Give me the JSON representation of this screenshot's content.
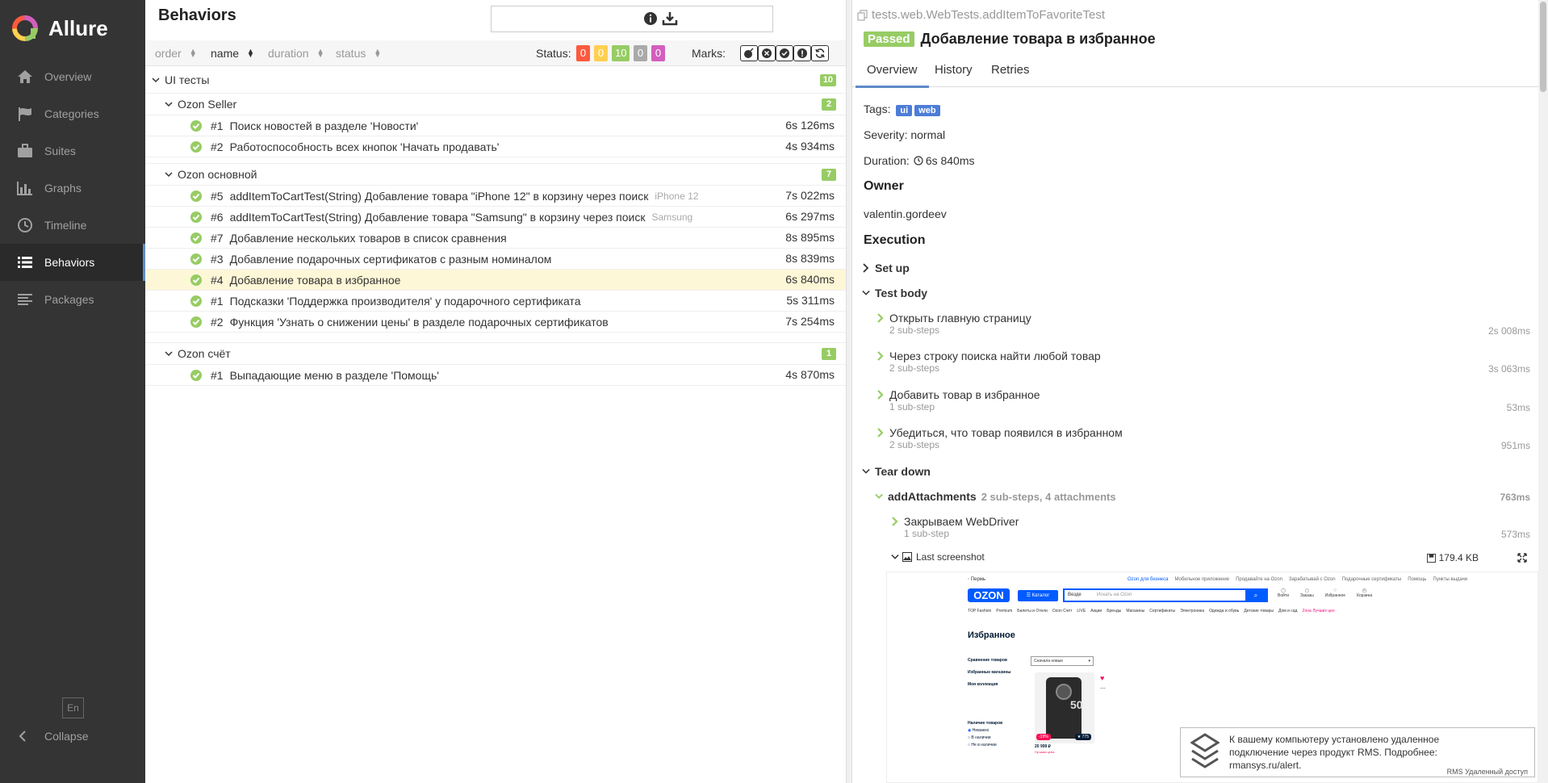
{
  "sidebar": {
    "brand": "Allure",
    "items": [
      {
        "label": "Overview",
        "icon": "home-icon"
      },
      {
        "label": "Categories",
        "icon": "flag-icon"
      },
      {
        "label": "Suites",
        "icon": "briefcase-icon"
      },
      {
        "label": "Graphs",
        "icon": "bar-chart-icon"
      },
      {
        "label": "Timeline",
        "icon": "clock-icon"
      },
      {
        "label": "Behaviors",
        "icon": "list-icon",
        "active": true
      },
      {
        "label": "Packages",
        "icon": "align-left-icon"
      }
    ],
    "lang": "En",
    "collapse": "Collapse"
  },
  "middle": {
    "title": "Behaviors",
    "search_value": "",
    "sort": {
      "order": "order",
      "name": "name",
      "duration": "duration",
      "status": "status"
    },
    "status_label": "Status:",
    "status_counts": [
      "0",
      "0",
      "10",
      "0",
      "0"
    ],
    "status_colors": [
      "#fd5a3e",
      "#ffd050",
      "#97cc64",
      "#aaaaaa",
      "#d35ebe"
    ],
    "marks_label": "Marks:",
    "root": {
      "label": "UI тесты",
      "count": "10"
    },
    "groups": [
      {
        "label": "Ozon Seller",
        "count": "2",
        "tests": [
          {
            "num": "#1",
            "name": "Поиск новостей в разделе 'Новости'",
            "param": "",
            "duration": "6s 126ms"
          },
          {
            "num": "#2",
            "name": "Работоспособность всех кнопок 'Начать продавать'",
            "param": "",
            "duration": "4s 934ms"
          }
        ]
      },
      {
        "label": "Ozon основной",
        "count": "7",
        "tests": [
          {
            "num": "#5",
            "name": "addItemToCartTest(String) Добавление товара \"iPhone 12\" в корзину через поиск",
            "param": "iPhone 12",
            "duration": "7s 022ms"
          },
          {
            "num": "#6",
            "name": "addItemToCartTest(String) Добавление товара \"Samsung\" в корзину через поиск",
            "param": "Samsung",
            "duration": "6s 297ms"
          },
          {
            "num": "#7",
            "name": "Добавление нескольких товаров в список сравнения",
            "param": "",
            "duration": "8s 895ms"
          },
          {
            "num": "#3",
            "name": "Добавление подарочных сертификатов с разным номиналом",
            "param": "",
            "duration": "8s 839ms"
          },
          {
            "num": "#4",
            "name": "Добавление товара в избранное",
            "param": "",
            "duration": "6s 840ms",
            "selected": true
          },
          {
            "num": "#1",
            "name": "Подсказки 'Поддержка производителя' у подарочного сертификата",
            "param": "",
            "duration": "5s 311ms"
          },
          {
            "num": "#2",
            "name": "Функция 'Узнать о снижении цены' в разделе подарочных сертификатов",
            "param": "",
            "duration": "7s 254ms"
          }
        ]
      },
      {
        "label": "Ozon счёт",
        "count": "1",
        "tests": [
          {
            "num": "#1",
            "name": "Выпадающие меню в разделе 'Помощь'",
            "param": "",
            "duration": "4s 870ms"
          }
        ]
      }
    ]
  },
  "right": {
    "fullname": "tests.web.WebTests.addItemToFavoriteTest",
    "status": "Passed",
    "title": "Добавление товара в избранное",
    "tabs": [
      "Overview",
      "History",
      "Retries"
    ],
    "tags_label": "Tags:",
    "tags": [
      "ui",
      "web"
    ],
    "severity": "Severity: normal",
    "duration_label": "Duration:",
    "duration": "6s 840ms",
    "owner_heading": "Owner",
    "owner": "valentin.gordeev",
    "execution_heading": "Execution",
    "setup": "Set up",
    "test_body": "Test body",
    "steps": [
      {
        "title": "Открыть главную страницу",
        "sub": "2 sub-steps",
        "duration": "2s 008ms"
      },
      {
        "title": "Через строку поиска найти любой товар",
        "sub": "2 sub-steps",
        "duration": "3s 063ms"
      },
      {
        "title": "Добавить товар в избранное",
        "sub": "1 sub-step",
        "duration": "53ms"
      },
      {
        "title": "Убедиться, что товар появился в избранном",
        "sub": "2 sub-steps",
        "duration": "951ms"
      }
    ],
    "teardown": "Tear down",
    "attach_step": {
      "title": "addAttachments",
      "meta": "2 sub-steps, 4 attachments",
      "duration": "763ms"
    },
    "webdriver_step": {
      "title": "Закрываем WebDriver",
      "sub": "1 sub-step",
      "duration": "573ms"
    },
    "attachment": {
      "name": "Last screenshot",
      "size": "179.4 KB"
    }
  },
  "screenshot": {
    "city": "Пермь",
    "top_links": [
      "Ozon для бизнеса",
      "Мобильное приложение",
      "Продавайте на Ozon",
      "Зарабатывай с Ozon",
      "Подарочные сертификаты",
      "Помощь",
      "Пункты выдачи"
    ],
    "logo": "OZON",
    "catalog": "Каталог",
    "search_scope": "Везде",
    "search_placeholder": "Искать на Ozon",
    "user_links": [
      "Войти",
      "Заказы",
      "Избранное",
      "Корзина"
    ],
    "nav_links": [
      "TOP Fashion",
      "Premium",
      "Билеты и Отели",
      "Ozon Счёт",
      "LIVE",
      "Акции",
      "Бренды",
      "Магазины",
      "Сертификаты",
      "Электроника",
      "Одежда и обувь",
      "Детские товары",
      "Дом и сад",
      "Zона Лучших цен"
    ],
    "heading": "Избранное",
    "side": [
      "Сравнение товаров",
      "Избранные магазины",
      "Моя коллекция"
    ],
    "sort_value": "Сначала новые",
    "avail_title": "Наличие товаров",
    "avail_options": [
      "Неважно",
      "В наличии",
      "Не в наличии"
    ],
    "badge_discount": "-19%",
    "badge_rating": "775",
    "price": "20 999 ₽",
    "price_note": "Лучшая цена"
  },
  "notice": {
    "text": "К вашему компьютеру установлено удаленное подключение через продукт RMS. Подробнее: rmansys.ru/alert.",
    "small": "RMS Удаленный доступ"
  }
}
